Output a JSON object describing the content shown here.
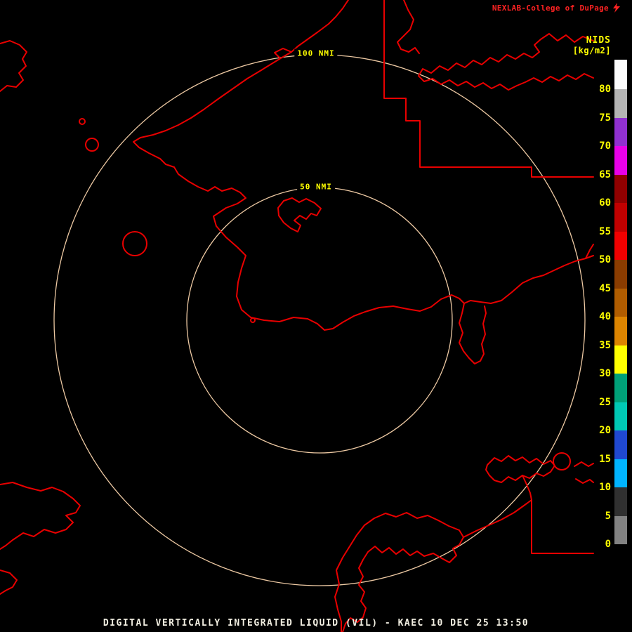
{
  "header": {
    "brand_text": "NEXLAB-College of DuPage",
    "brand_color": "#ff2222"
  },
  "colorbar": {
    "title": "NIDS",
    "units_label": "[kg/m2]",
    "text_color": "#ffff00",
    "ticks": [
      "80",
      "75",
      "70",
      "65",
      "60",
      "55",
      "50",
      "45",
      "40",
      "35",
      "30",
      "25",
      "20",
      "15",
      "10",
      "5",
      "0"
    ],
    "segments_top_to_bottom": [
      {
        "range": "80+",
        "color": "#fcfcfc"
      },
      {
        "range": "75-80",
        "color": "#b4b4b4"
      },
      {
        "range": "70-75",
        "color": "#9030d0"
      },
      {
        "range": "65-70",
        "color": "#e800e8"
      },
      {
        "range": "60-65",
        "color": "#900000"
      },
      {
        "range": "55-60",
        "color": "#c00000"
      },
      {
        "range": "50-55",
        "color": "#f00000"
      },
      {
        "range": "45-50",
        "color": "#8a3c00"
      },
      {
        "range": "40-45",
        "color": "#b05c00"
      },
      {
        "range": "35-40",
        "color": "#dc8400"
      },
      {
        "range": "30-35",
        "color": "#ffff00"
      },
      {
        "range": "25-30",
        "color": "#00a078"
      },
      {
        "range": "20-25",
        "color": "#00c8b4"
      },
      {
        "range": "15-20",
        "color": "#2048d0"
      },
      {
        "range": "10-15",
        "color": "#00b4ff"
      },
      {
        "range": "5-10",
        "color": "#303030"
      },
      {
        "range": "0-5",
        "color": "#828282"
      }
    ]
  },
  "range_rings": {
    "ring_color": "#edc9a3",
    "label_color": "#ffff00",
    "outer": {
      "label": "100 NMI"
    },
    "inner": {
      "label": "50 NMI"
    }
  },
  "map": {
    "coastline_color": "#e80000"
  },
  "footer": {
    "caption": "DIGITAL VERTICALLY INTEGRATED LIQUID (VIL) - KAEC 10 DEC 25 13:50",
    "text_color": "#f2efe2"
  }
}
